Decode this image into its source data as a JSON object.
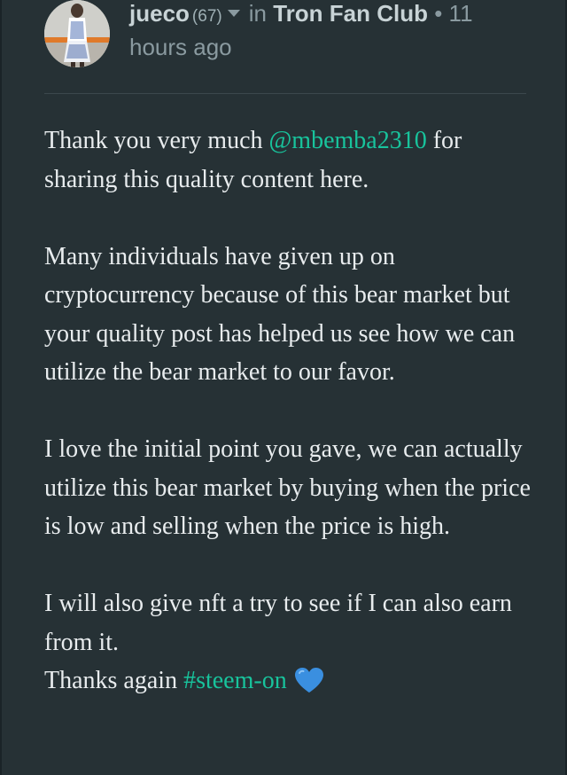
{
  "post": {
    "author": "jueco",
    "reputation": "(67)",
    "in_label": "in",
    "community": "Tron Fan Club",
    "separator": "•",
    "time_ago": "11 hours ago"
  },
  "comment": {
    "p1_before": "Thank you very much ",
    "p1_mention": "@mbemba2310",
    "p1_after": " for sharing this quality content here.",
    "p2": "Many individuals have given up on cryptocurrency because of this bear market but your quality post has helped us see how we can utilize the bear market to our favor.",
    "p3": "I love the initial point you gave, we can actually utilize this bear market by buying when the price is low and selling when the price is high.",
    "p4": "I will also give nft a try to see if I can also earn from it.",
    "p5_before": "Thanks again ",
    "p5_tag": "#steem-on",
    "emoji": "blue-heart-icon"
  },
  "colors": {
    "background": "#263135",
    "link": "#18c39c",
    "text": "#e8ecee",
    "muted": "#8a9aa0",
    "heart": "#3a8fe0"
  }
}
